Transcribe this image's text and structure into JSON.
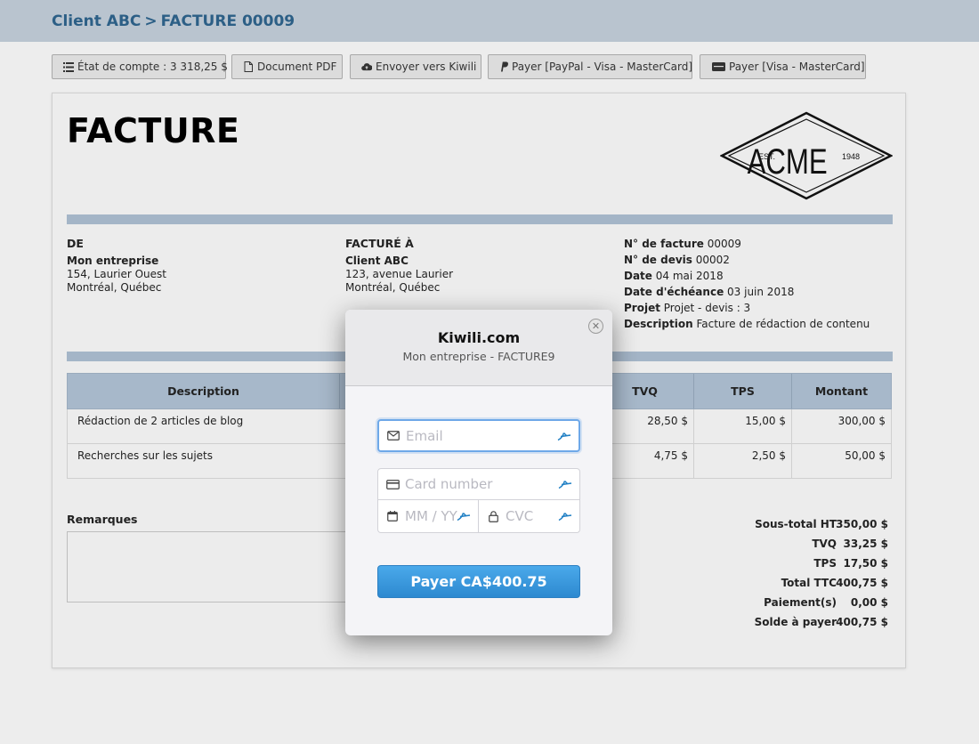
{
  "breadcrumb": {
    "client": "Client ABC",
    "separator": ">",
    "invoice": "FACTURE 00009"
  },
  "toolbar": [
    {
      "label": "État de compte : 3 318,25 $",
      "icon": "list-icon"
    },
    {
      "label": "Document PDF",
      "icon": "pdf-icon"
    },
    {
      "label": "Envoyer vers Kiwili",
      "icon": "cloud-upload-icon"
    },
    {
      "label": "Payer [PayPal - Visa - MasterCard]",
      "icon": "paypal-icon"
    },
    {
      "label": "Payer [Visa - MasterCard]",
      "icon": "stripe-icon"
    }
  ],
  "invoice": {
    "title": "FACTURE",
    "logo": {
      "est": "EST.",
      "name": "ACME",
      "year": "1948"
    },
    "from": {
      "heading": "DE",
      "name": "Mon entreprise",
      "address1": "154, Laurier Ouest",
      "address2": "Montréal, Québec"
    },
    "to": {
      "heading": "FACTURÉ À",
      "name": "Client ABC",
      "address1": "123, avenue Laurier",
      "address2": "Montréal, Québec"
    },
    "meta": [
      {
        "label": "N° de facture",
        "value": "00009"
      },
      {
        "label": "N° de devis",
        "value": "00002"
      },
      {
        "label": "Date",
        "value": "04 mai 2018"
      },
      {
        "label": "Date d'échéance",
        "value": "03 juin 2018"
      },
      {
        "label": "Projet",
        "value": "Projet - devis : 3"
      },
      {
        "label": "Description",
        "value": "Facture de rédaction de contenu"
      }
    ],
    "table": {
      "headers": {
        "description": "Description",
        "tvq": "TVQ",
        "tps": "TPS",
        "montant": "Montant"
      },
      "rows": [
        {
          "description": "Rédaction de 2 articles de blog",
          "tvq": "28,50 $",
          "tps": "15,00 $",
          "montant": "300,00 $"
        },
        {
          "description": "Recherches sur les sujets",
          "tvq": "4,75 $",
          "tps": "2,50 $",
          "montant": "50,00 $"
        }
      ]
    },
    "remarks_label": "Remarques",
    "totals": [
      {
        "label": "Sous-total HT",
        "value": "350,00 $"
      },
      {
        "label": "TVQ",
        "value": "33,25 $"
      },
      {
        "label": "TPS",
        "value": "17,50 $"
      },
      {
        "label": "Total TTC",
        "value": "400,75 $"
      },
      {
        "label": "Paiement(s)",
        "value": "0,00 $"
      },
      {
        "label": "Solde à payer",
        "value": "400,75 $"
      }
    ]
  },
  "modal": {
    "title": "Kiwili.com",
    "subtitle": "Mon entreprise - FACTURE9",
    "email_placeholder": "Email",
    "card_placeholder": "Card number",
    "expiry_placeholder": "MM / YY",
    "cvc_placeholder": "CVC",
    "pay_label": "Payer CA$400.75"
  },
  "colors": {
    "accent": "#2c5f86",
    "band": "#a4b5c7",
    "pay_button": "#3a9be0"
  }
}
